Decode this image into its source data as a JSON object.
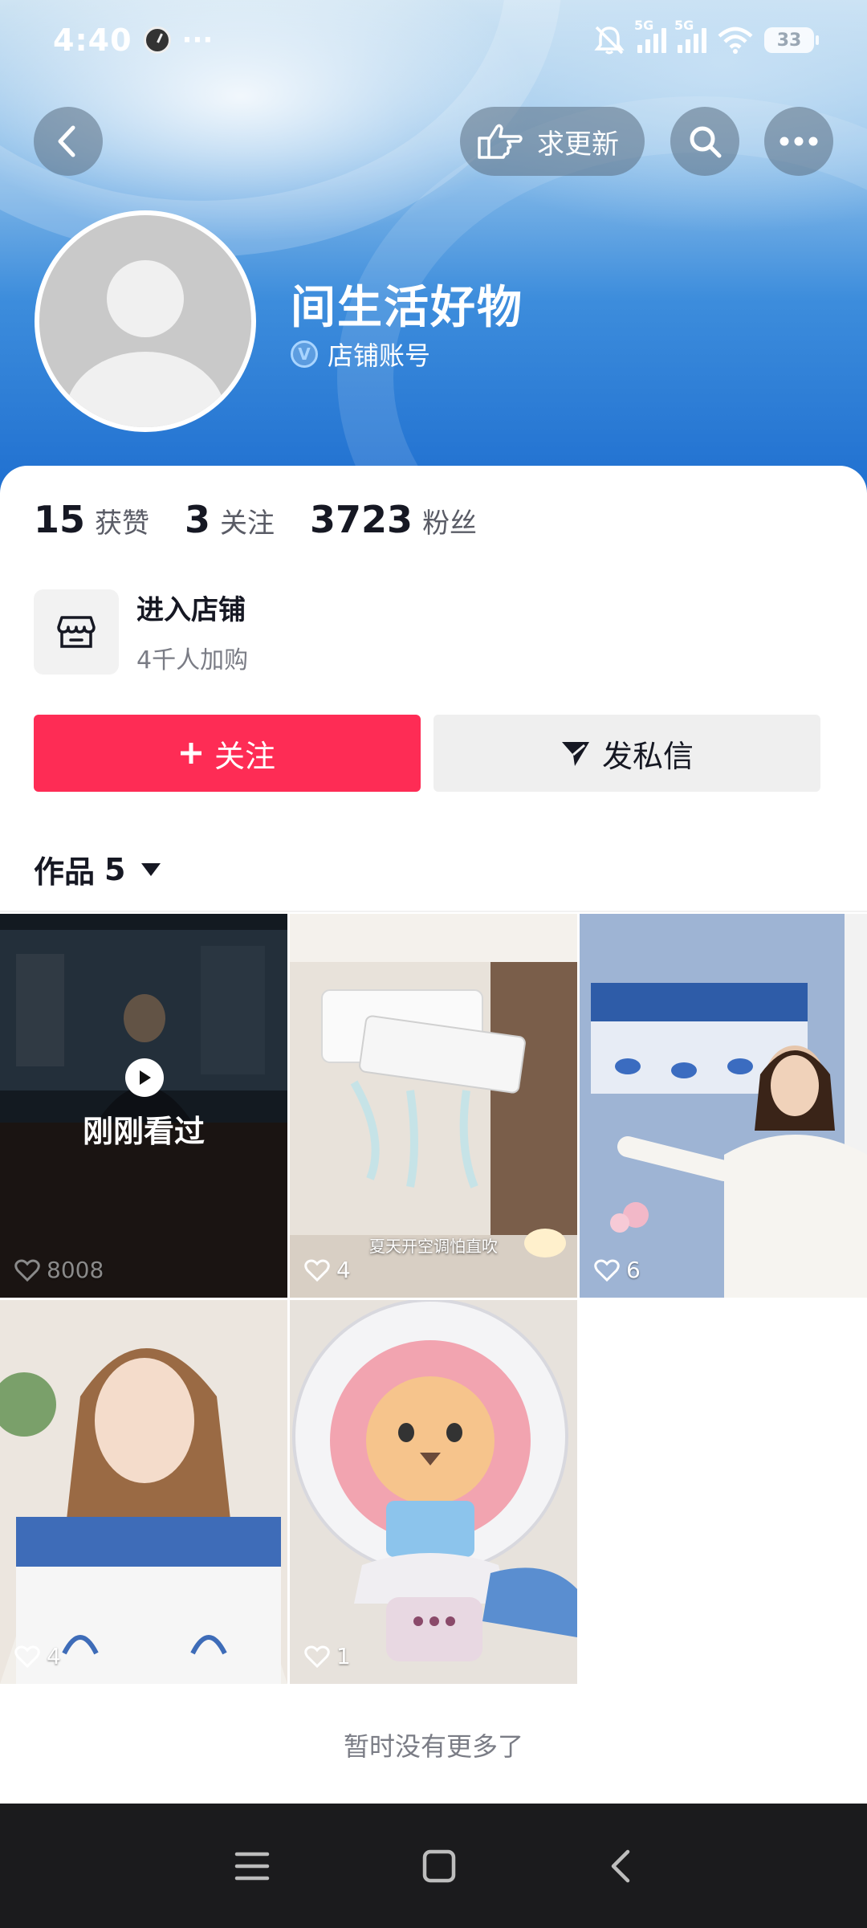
{
  "status_bar": {
    "time": "4:40",
    "dots": "···",
    "net1": "5G",
    "net2": "5G",
    "battery": "33"
  },
  "top_nav": {
    "request_update_label": "求更新"
  },
  "profile": {
    "nickname": "间生活好物",
    "account_type": "店铺账号",
    "verified_badge": "V"
  },
  "stats": [
    {
      "value": "15",
      "label": "获赞"
    },
    {
      "value": "3",
      "label": "关注"
    },
    {
      "value": "3723",
      "label": "粉丝"
    }
  ],
  "store": {
    "title": "进入店铺",
    "subtitle": "4千人加购"
  },
  "actions": {
    "follow_label": "关注",
    "message_label": "发私信"
  },
  "works_tab": {
    "label": "作品",
    "count": "5"
  },
  "videos": [
    {
      "likes": "8008",
      "seen_label": "刚刚看过",
      "caption": ""
    },
    {
      "likes": "4",
      "caption": "夏天开空调怕直吹"
    },
    {
      "likes": "6",
      "caption": ""
    },
    {
      "likes": "4",
      "caption": ""
    },
    {
      "likes": "1",
      "caption": ""
    }
  ],
  "footer_text": "暂时没有更多了",
  "colors": {
    "follow_red": "#fe2c55",
    "hero_blue": "#1f6fd0"
  }
}
